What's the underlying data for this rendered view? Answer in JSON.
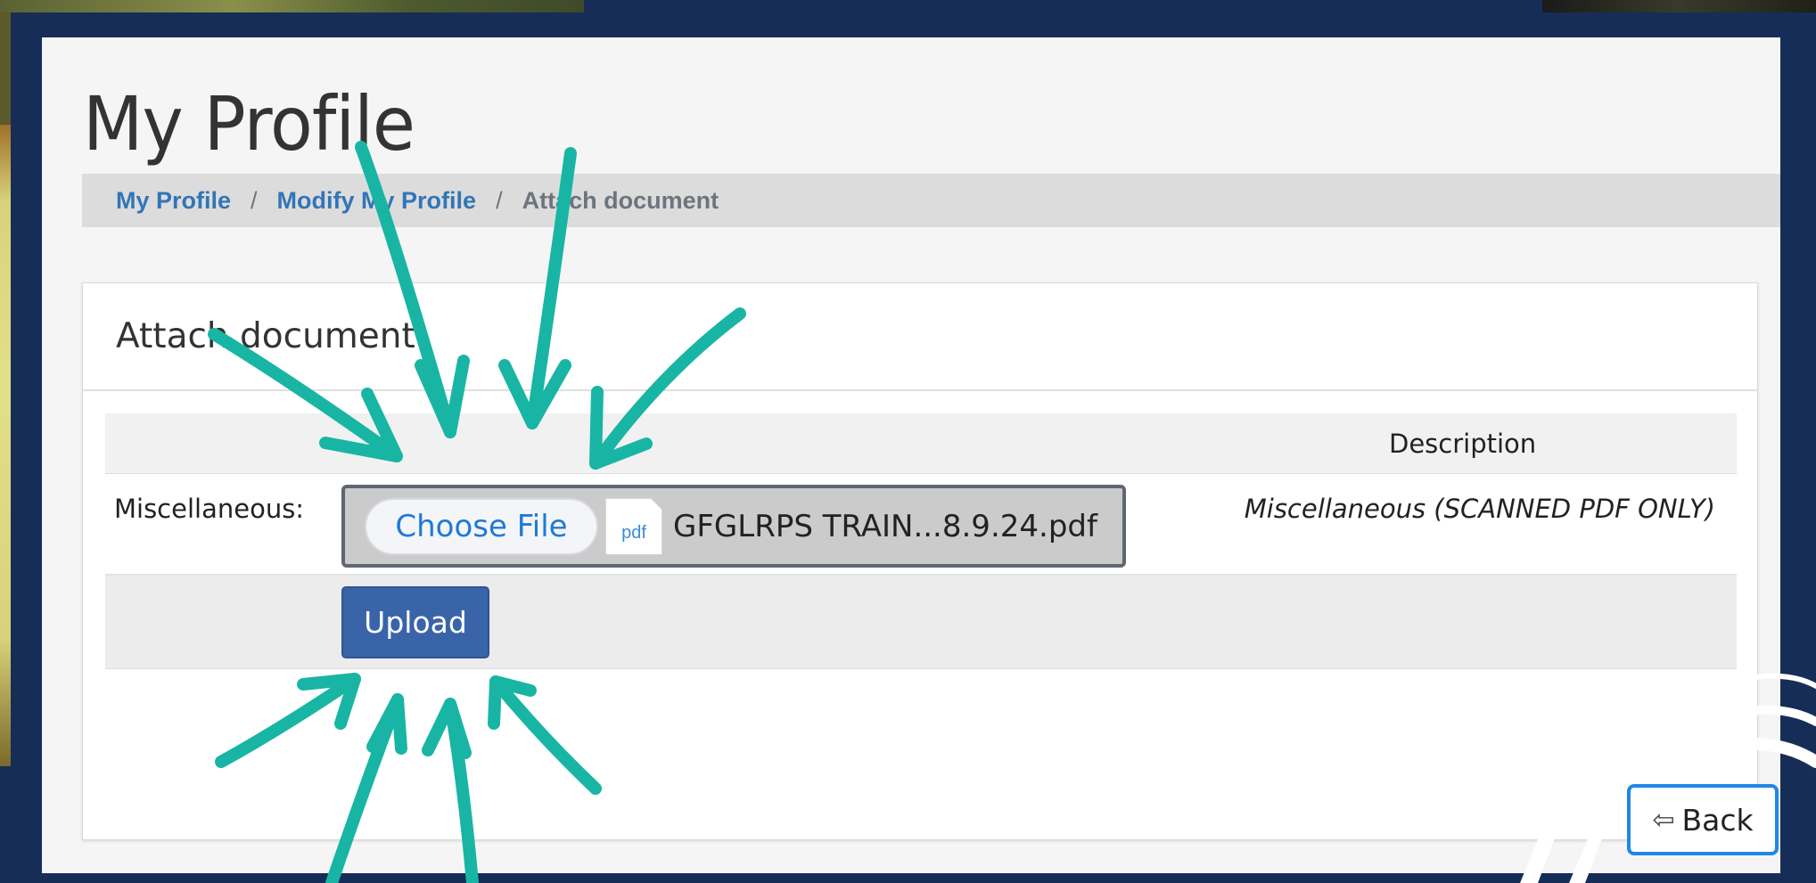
{
  "page": {
    "title": "My Profile"
  },
  "breadcrumb": {
    "items": [
      {
        "label": "My Profile"
      },
      {
        "label": "Modify My Profile"
      },
      {
        "label": "Attach document"
      }
    ],
    "separator": "/"
  },
  "card": {
    "title": "Attach document",
    "table": {
      "column_headers": [
        "",
        "Description"
      ],
      "row": {
        "label": "Miscellaneous:",
        "file_input": {
          "button_label": "Choose File",
          "file_type_badge": "pdf",
          "selected_file": "GFGLRPS TRAIN...8.9.24.pdf"
        },
        "description": "Miscellaneous (SCANNED PDF ONLY)"
      },
      "upload_label": "Upload"
    },
    "back_label": "Back"
  },
  "colors": {
    "link": "#3275b8",
    "primary_button": "#3a64a8",
    "annotation_arrow": "#18b5a5",
    "frame": "#162d57",
    "back_border": "#1e88e5"
  }
}
